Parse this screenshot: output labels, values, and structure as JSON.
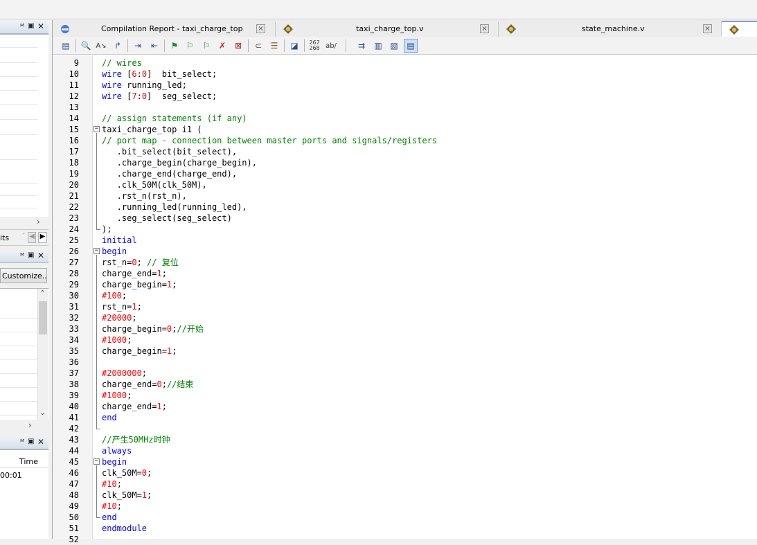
{
  "colors": {
    "keyword": "#0000ff",
    "comment": "#008000",
    "number": "#ff0000",
    "plain": "#000000"
  },
  "left_panel": {
    "pane1_title_icons": "p ▣ ×",
    "tabs_label": "its",
    "pane2_title_icons": "p ▣ ×",
    "customize_label": "Customize...",
    "pane3_title_icons": "p ▣ ×",
    "time_header": "Time",
    "time_value": "00:01"
  },
  "tabs": [
    {
      "label": "Compilation Report - taxi_charge_top",
      "icon": "compilation-report-icon"
    },
    {
      "label": "taxi_charge_top.v",
      "icon": "verilog-file-icon"
    },
    {
      "label": "state_machine.v",
      "icon": "verilog-file-icon"
    },
    {
      "label": "",
      "icon": "verilog-file-icon"
    }
  ],
  "toolbar": {
    "icons": [
      "insert-template-icon",
      "find-icon",
      "find-replace-icon",
      "goto-line-icon",
      "indent-icon",
      "unindent-icon",
      "bookmark-toggle-icon",
      "bookmark-next-icon",
      "bookmark-prev-icon",
      "bookmark-clear-icon",
      "bookmark-delete-icon",
      "attach-icon",
      "scroll-icon",
      "comment-block-icon",
      "line-numbers-icon",
      "ab-slash-icon",
      "insert-arrow-icon",
      "collapse-icon",
      "expand-icon",
      "list-view-icon"
    ],
    "line_numbers_text": "267\n268",
    "ab_text": "ab/"
  },
  "code": [
    {
      "n": "9",
      "segs": [
        [
          "cm",
          "// wires"
        ]
      ]
    },
    {
      "n": "10",
      "segs": [
        [
          "kw",
          "wire"
        ],
        [
          "pl",
          " ["
        ],
        [
          "num",
          "6"
        ],
        [
          "pl",
          ":"
        ],
        [
          "num",
          "0"
        ],
        [
          "pl",
          "]  bit_select;"
        ]
      ]
    },
    {
      "n": "11",
      "segs": [
        [
          "kw",
          "wire"
        ],
        [
          "pl",
          " running_led;"
        ]
      ]
    },
    {
      "n": "12",
      "segs": [
        [
          "kw",
          "wire"
        ],
        [
          "pl",
          " ["
        ],
        [
          "num",
          "7"
        ],
        [
          "pl",
          ":"
        ],
        [
          "num",
          "0"
        ],
        [
          "pl",
          "]  seg_select;"
        ]
      ]
    },
    {
      "n": "13",
      "segs": []
    },
    {
      "n": "14",
      "segs": [
        [
          "cm",
          "// assign statements (if any)"
        ]
      ]
    },
    {
      "n": "15",
      "fold": "start",
      "segs": [
        [
          "pl",
          "taxi_charge_top i1 ("
        ]
      ]
    },
    {
      "n": "16",
      "segs": [
        [
          "cm",
          "// port map - connection between master ports and signals/registers"
        ]
      ]
    },
    {
      "n": "17",
      "segs": [
        [
          "pl",
          "   .bit_select(bit_select),"
        ]
      ]
    },
    {
      "n": "18",
      "segs": [
        [
          "pl",
          "   .charge_begin(charge_begin),"
        ]
      ]
    },
    {
      "n": "19",
      "segs": [
        [
          "pl",
          "   .charge_end(charge_end),"
        ]
      ]
    },
    {
      "n": "20",
      "segs": [
        [
          "pl",
          "   .clk_50M(clk_50M),"
        ]
      ]
    },
    {
      "n": "21",
      "segs": [
        [
          "pl",
          "   .rst_n(rst_n),"
        ]
      ]
    },
    {
      "n": "22",
      "segs": [
        [
          "pl",
          "   .running_led(running_led),"
        ]
      ]
    },
    {
      "n": "23",
      "segs": [
        [
          "pl",
          "   .seg_select(seg_select)"
        ]
      ]
    },
    {
      "n": "24",
      "fold": "end",
      "segs": [
        [
          "pl",
          ");"
        ]
      ]
    },
    {
      "n": "25",
      "segs": [
        [
          "kw",
          "initial"
        ]
      ]
    },
    {
      "n": "26",
      "fold": "start",
      "segs": [
        [
          "kw",
          "begin"
        ]
      ]
    },
    {
      "n": "27",
      "segs": [
        [
          "pl",
          "rst_n="
        ],
        [
          "num",
          "0"
        ],
        [
          "pl",
          "; "
        ],
        [
          "cm",
          "// 复位"
        ]
      ]
    },
    {
      "n": "28",
      "segs": [
        [
          "pl",
          "charge_end="
        ],
        [
          "num",
          "1"
        ],
        [
          "pl",
          ";"
        ]
      ]
    },
    {
      "n": "29",
      "segs": [
        [
          "pl",
          "charge_begin="
        ],
        [
          "num",
          "1"
        ],
        [
          "pl",
          ";"
        ]
      ]
    },
    {
      "n": "30",
      "segs": [
        [
          "num",
          "#100"
        ],
        [
          "pl",
          ";"
        ]
      ]
    },
    {
      "n": "31",
      "segs": [
        [
          "pl",
          "rst_n="
        ],
        [
          "num",
          "1"
        ],
        [
          "pl",
          ";"
        ]
      ]
    },
    {
      "n": "32",
      "segs": [
        [
          "num",
          "#20000"
        ],
        [
          "pl",
          ";"
        ]
      ]
    },
    {
      "n": "33",
      "segs": [
        [
          "pl",
          "charge_begin="
        ],
        [
          "num",
          "0"
        ],
        [
          "pl",
          ";"
        ],
        [
          "cm",
          "//开始"
        ]
      ]
    },
    {
      "n": "34",
      "segs": [
        [
          "num",
          "#1000"
        ],
        [
          "pl",
          ";"
        ]
      ]
    },
    {
      "n": "35",
      "segs": [
        [
          "pl",
          "charge_begin="
        ],
        [
          "num",
          "1"
        ],
        [
          "pl",
          ";"
        ]
      ]
    },
    {
      "n": "36",
      "segs": []
    },
    {
      "n": "37",
      "segs": [
        [
          "num",
          "#2000000"
        ],
        [
          "pl",
          ";"
        ]
      ]
    },
    {
      "n": "38",
      "segs": [
        [
          "pl",
          "charge_end="
        ],
        [
          "num",
          "0"
        ],
        [
          "pl",
          ";"
        ],
        [
          "cm",
          "//结束"
        ]
      ]
    },
    {
      "n": "39",
      "segs": [
        [
          "num",
          "#1000"
        ],
        [
          "pl",
          ";"
        ]
      ]
    },
    {
      "n": "40",
      "segs": [
        [
          "pl",
          "charge_end="
        ],
        [
          "num",
          "1"
        ],
        [
          "pl",
          ";"
        ]
      ]
    },
    {
      "n": "41",
      "segs": [
        [
          "kw",
          "end"
        ]
      ]
    },
    {
      "n": "42",
      "fold": "end",
      "segs": []
    },
    {
      "n": "43",
      "segs": [
        [
          "cm",
          "//产生50MHz时钟"
        ]
      ]
    },
    {
      "n": "44",
      "segs": [
        [
          "kw",
          "always"
        ]
      ]
    },
    {
      "n": "45",
      "fold": "start",
      "segs": [
        [
          "kw",
          "begin"
        ]
      ]
    },
    {
      "n": "46",
      "segs": [
        [
          "pl",
          "clk_50M="
        ],
        [
          "num",
          "0"
        ],
        [
          "pl",
          ";"
        ]
      ]
    },
    {
      "n": "47",
      "segs": [
        [
          "num",
          "#10"
        ],
        [
          "pl",
          ";"
        ]
      ]
    },
    {
      "n": "48",
      "segs": [
        [
          "pl",
          "clk_50M="
        ],
        [
          "num",
          "1"
        ],
        [
          "pl",
          ";"
        ]
      ]
    },
    {
      "n": "49",
      "segs": [
        [
          "num",
          "#10"
        ],
        [
          "pl",
          ";"
        ]
      ]
    },
    {
      "n": "50",
      "fold": "end",
      "segs": [
        [
          "kw",
          "end"
        ]
      ]
    },
    {
      "n": "51",
      "segs": [
        [
          "kw",
          "endmodule"
        ]
      ]
    },
    {
      "n": "52",
      "segs": []
    }
  ]
}
